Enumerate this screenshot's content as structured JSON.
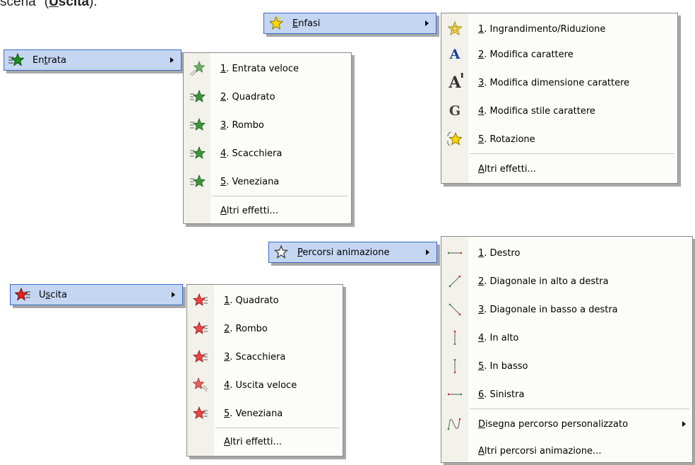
{
  "top_text": {
    "pre": "scena\" (",
    "bold_u": "U",
    "bold_u2": "s",
    "bold_rest": "cita",
    "post": ")."
  },
  "colors": {
    "highlight": "#c5d6f2",
    "highlight_border": "#3c69c9",
    "menu_bg": "#fcfcf9",
    "strip": "#f2f1ea"
  },
  "enfasi": {
    "label_prefix": "",
    "accel": "E",
    "label_rest": "nfasi",
    "items": [
      {
        "num": "1",
        "text": ". Ingrandimento/Riduzione",
        "icon": "grow-shrink-icon"
      },
      {
        "num": "2",
        "text": ". Modifica carattere",
        "icon": "font-change-icon"
      },
      {
        "num": "3",
        "text": ". Modifica dimensione carattere",
        "icon": "font-size-icon"
      },
      {
        "num": "4",
        "text": ". Modifica stile carattere",
        "icon": "font-style-icon"
      },
      {
        "num": "5",
        "text": ". Rotazione",
        "icon": "spin-star-icon"
      }
    ],
    "more_accel": "A",
    "more_rest": "ltri effetti..."
  },
  "entrata": {
    "label_prefix": "En",
    "accel": "t",
    "label_rest": "rata",
    "items": [
      {
        "num": "1",
        "text": ". Entrata veloce",
        "icon": "fly-in-star-icon"
      },
      {
        "num": "2",
        "text": ". Quadrato",
        "icon": "green-star-icon"
      },
      {
        "num": "3",
        "text": ". Rombo",
        "icon": "green-star-icon"
      },
      {
        "num": "4",
        "text": ". Scacchiera",
        "icon": "green-star-icon"
      },
      {
        "num": "5",
        "text": ". Veneziana",
        "icon": "green-star-icon"
      }
    ],
    "more_accel": "A",
    "more_rest": "ltri effetti..."
  },
  "percorsi": {
    "label_prefix": "",
    "accel": "P",
    "label_rest": "ercorsi animazione",
    "items": [
      {
        "num": "1",
        "text": ". Destro",
        "icon": "path-right-icon"
      },
      {
        "num": "2",
        "text": ". Diagonale in alto a destra",
        "icon": "path-diag-up-icon"
      },
      {
        "num": "3",
        "text": ". Diagonale in basso a destra",
        "icon": "path-diag-down-icon"
      },
      {
        "num": "4",
        "text": ". In alto",
        "icon": "path-up-icon"
      },
      {
        "num": "5",
        "text": ". In basso",
        "icon": "path-down-icon"
      },
      {
        "num": "6",
        "text": ". Sinistra",
        "icon": "path-left-icon"
      }
    ],
    "custom_accel": "D",
    "custom_rest": "isegna percorso personalizzato",
    "more_accel": "A",
    "more_rest": "ltri percorsi animazione..."
  },
  "uscita": {
    "label_prefix": "U",
    "accel": "s",
    "label_rest": "cita",
    "items": [
      {
        "num": "1",
        "text": ". Quadrato",
        "icon": "red-star-icon"
      },
      {
        "num": "2",
        "text": ". Rombo",
        "icon": "red-star-icon"
      },
      {
        "num": "3",
        "text": ". Scacchiera",
        "icon": "red-star-icon"
      },
      {
        "num": "4",
        "text": ". Uscita veloce",
        "icon": "fly-out-star-icon"
      },
      {
        "num": "5",
        "text": ". Veneziana",
        "icon": "red-star-icon"
      }
    ],
    "more_accel": "A",
    "more_rest": "ltri effetti..."
  }
}
